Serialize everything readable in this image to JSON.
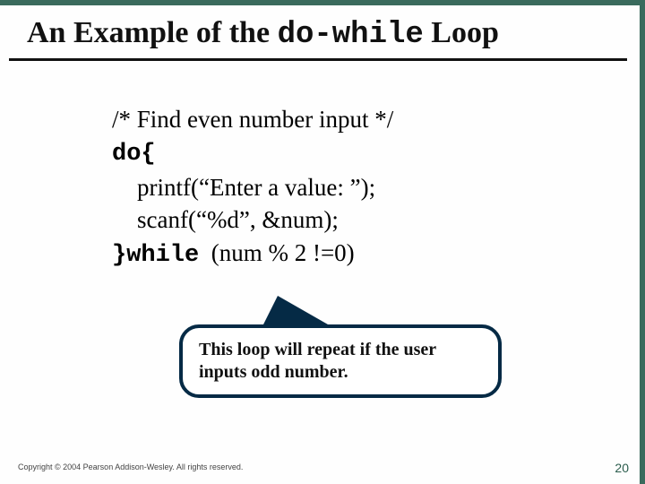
{
  "title": {
    "pre": "An Example of the ",
    "code": "do-while",
    "post": " Loop"
  },
  "code": {
    "l1": "/* Find even number input */",
    "l2": "do{",
    "l3": "printf(“Enter a value: ”);",
    "l4": "scanf(“%d”, &num);",
    "l5a": "}",
    "l5b": "while",
    "l5c": "  (num % 2 !=0)"
  },
  "callout": "This loop will repeat if the user inputs odd number.",
  "copyright": "Copyright © 2004 Pearson Addison-Wesley. All rights reserved.",
  "pagenum": "20"
}
